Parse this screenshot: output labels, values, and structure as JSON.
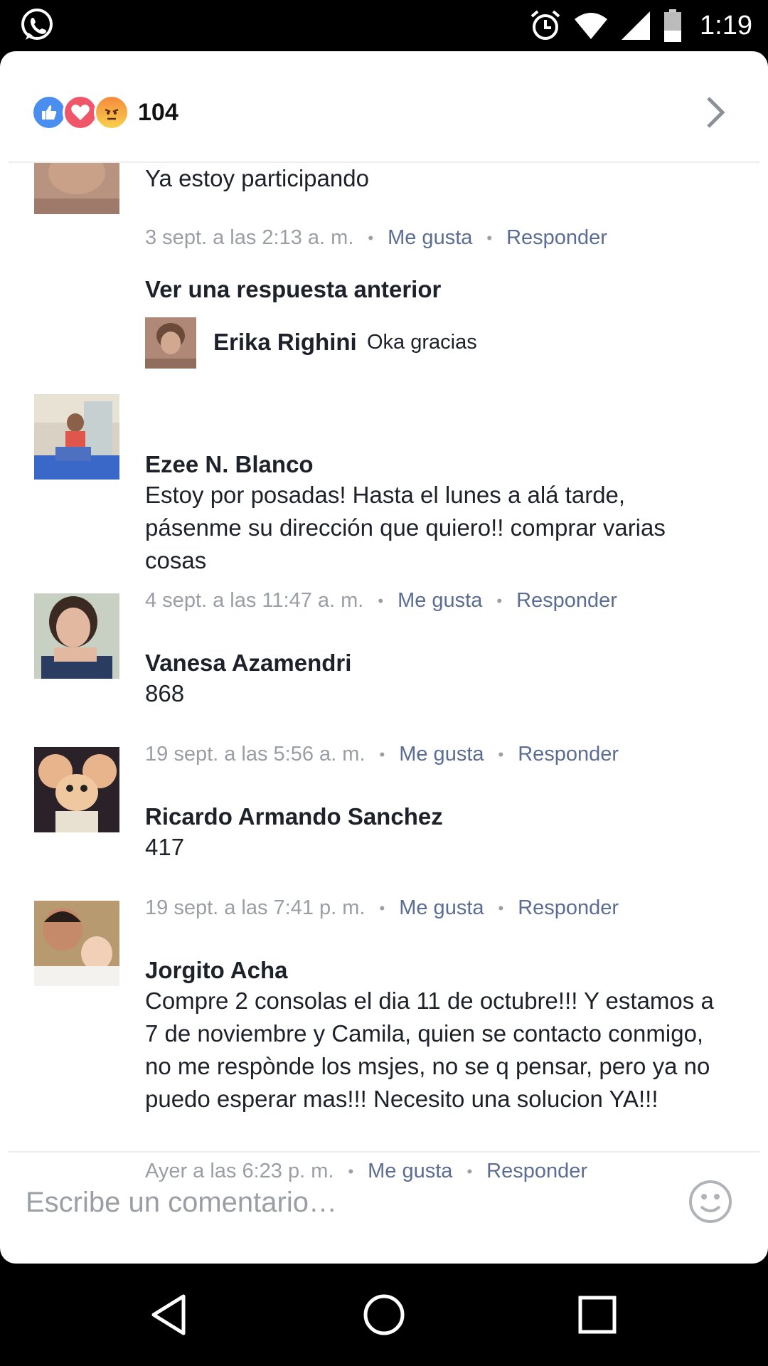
{
  "status_bar": {
    "time": "1:19",
    "icons": [
      "whatsapp-icon",
      "alarm-icon",
      "wifi-icon",
      "signal-icon",
      "battery-icon"
    ]
  },
  "reactions": {
    "count": "104",
    "types": [
      "like",
      "love",
      "angry"
    ]
  },
  "comments": [
    {
      "text": "Ya estoy participando",
      "timestamp": "3 sept. a las 2:13 a. m.",
      "like": "Me gusta",
      "reply": "Responder"
    },
    {
      "name": "Ezee N. Blanco",
      "text": "Estoy por posadas! Hasta el lunes a alá tarde, pásenme su dirección que quiero!! comprar varias cosas",
      "timestamp": "4 sept. a las 11:47 a. m.",
      "like": "Me gusta",
      "reply": "Responder"
    },
    {
      "name": "Vanesa Azamendri",
      "text": "868",
      "timestamp": "19 sept. a las 5:56 a. m.",
      "like": "Me gusta",
      "reply": "Responder"
    },
    {
      "name": "Ricardo Armando Sanchez",
      "text": "417",
      "timestamp": "19 sept. a las 7:41 p. m.",
      "like": "Me gusta",
      "reply": "Responder"
    },
    {
      "name": "Jorgito Acha",
      "text": "Compre 2 consolas el dia 11 de octubre!!! Y estamos a 7 de noviembre y Camila, quien se contacto conmigo, no me respònde los msjes, no se q pensar, pero ya no puedo esperar mas!!! Necesito una solucion YA!!!",
      "timestamp": "Ayer a las 6:23 p. m.",
      "like": "Me gusta",
      "reply": "Responder"
    }
  ],
  "previous_replies": {
    "label": "Ver una respuesta anterior",
    "reply_name": "Erika Righini",
    "reply_text": "Oka gracias"
  },
  "composer": {
    "placeholder": "Escribe un comentario…"
  },
  "colors": {
    "link": "#5b6d92",
    "meta": "#9a9ea5",
    "like_blue": "#4a8ef0",
    "love_red": "#f0566a"
  }
}
